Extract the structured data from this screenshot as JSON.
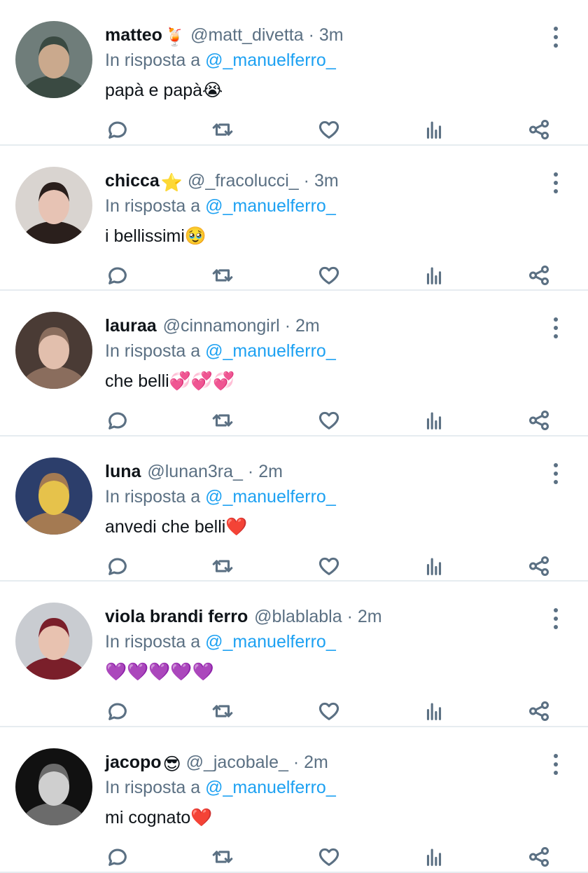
{
  "tweets": [
    {
      "name": "matteo",
      "name_emoji": "🍹",
      "handle": "@matt_divetta",
      "time": "3m",
      "reply_prefix": "In risposta a",
      "reply_to": "@_manuelferro_",
      "text": "papà e papà",
      "text_emoji": "😭",
      "avatar_colors": [
        "#6f7d7a",
        "#3a4a42",
        "#caa98d"
      ]
    },
    {
      "name": "chicca",
      "name_emoji": "⭐",
      "handle": "@_fracolucci_",
      "time": "3m",
      "reply_prefix": "In risposta a",
      "reply_to": "@_manuelferro_",
      "text": "i bellissimi",
      "text_emoji": "🥹",
      "avatar_colors": [
        "#d9d4d0",
        "#2a1f1c",
        "#e7c3b4"
      ]
    },
    {
      "name": "lauraa",
      "name_emoji": "",
      "handle": "@cinnamongirl",
      "time": "2m",
      "reply_prefix": "In risposta a",
      "reply_to": "@_manuelferro_",
      "text": "che belli",
      "text_emoji": "💞💞💞",
      "avatar_colors": [
        "#4a3b35",
        "#8a6d5d",
        "#e2bfad"
      ]
    },
    {
      "name": "luna",
      "name_emoji": "",
      "handle": "@lunan3ra_",
      "time": "2m",
      "reply_prefix": "In risposta a",
      "reply_to": "@_manuelferro_",
      "text": "anvedi che belli",
      "text_emoji": "❤️",
      "avatar_colors": [
        "#2c3e6b",
        "#a47a52",
        "#e6c24b"
      ]
    },
    {
      "name": "viola brandi ferro",
      "name_emoji": "",
      "handle": "@blablabla",
      "time": "2m",
      "reply_prefix": "In risposta a",
      "reply_to": "@_manuelferro_",
      "text": "",
      "text_emoji": "💜💜💜💜💜",
      "avatar_colors": [
        "#c9ccd1",
        "#7a1f2a",
        "#e8c2b0"
      ]
    },
    {
      "name": "jacopo",
      "name_emoji": "😎",
      "handle": "@_jacobale_",
      "time": "2m",
      "reply_prefix": "In risposta a",
      "reply_to": "@_manuelferro_",
      "text": "mi cognato",
      "text_emoji": "❤️",
      "avatar_colors": [
        "#111111",
        "#6b6b6b",
        "#cfcfcf"
      ]
    }
  ],
  "icons": {
    "menu": "more-vertical-icon",
    "reply": "comment-icon",
    "retweet": "retweet-icon",
    "like": "heart-icon",
    "analytics": "analytics-icon",
    "share": "share-icon"
  },
  "colors": {
    "handle": "#5b7083",
    "mention": "#1da1f2",
    "divider": "#e6ecf0"
  }
}
